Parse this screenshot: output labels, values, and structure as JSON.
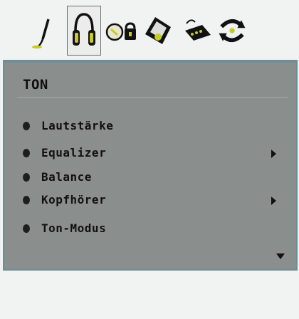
{
  "icon_bar": {
    "tabs": [
      {
        "icon": "picture-brush-icon",
        "active": false
      },
      {
        "icon": "headphones-icon",
        "active": true
      },
      {
        "icon": "clock-lock-icon",
        "active": false
      },
      {
        "icon": "settings-tilt-icon",
        "active": false
      },
      {
        "icon": "remote-robot-icon",
        "active": false
      },
      {
        "icon": "source-arrows-icon",
        "active": false
      }
    ]
  },
  "menu": {
    "title": "TON",
    "items": [
      {
        "label": "Lautstärke",
        "has_submenu": false
      },
      {
        "label": "Equalizer",
        "has_submenu": true
      },
      {
        "label": "Balance",
        "has_submenu": false
      },
      {
        "label": "Kopfhörer",
        "has_submenu": true
      },
      {
        "label": "Ton-Modus",
        "has_submenu": false
      }
    ]
  },
  "colors": {
    "panel_bg": "#8a8f8e",
    "panel_border": "#6f8f98",
    "page_bg": "#f1f2f2"
  }
}
